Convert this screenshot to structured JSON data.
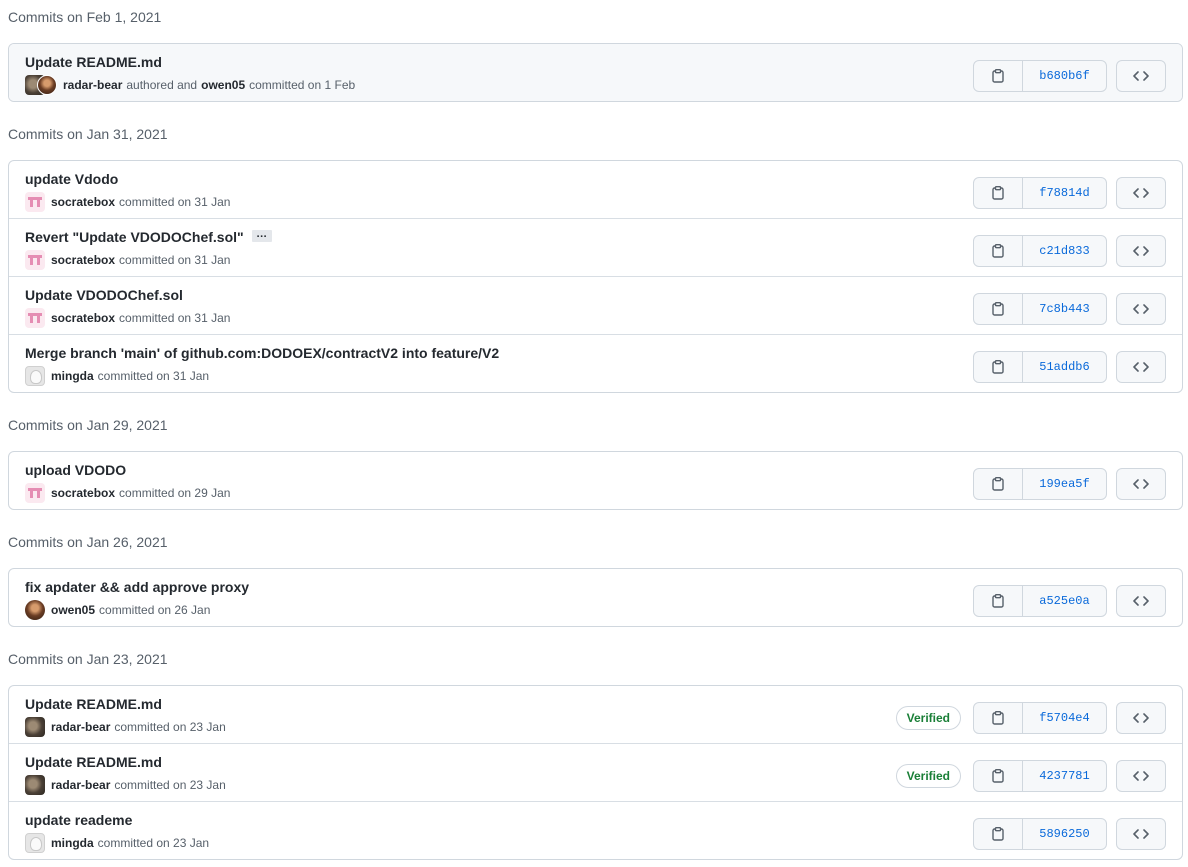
{
  "groups": [
    {
      "heading": "Commits on Feb 1, 2021",
      "commits": [
        {
          "title": "Update README.md",
          "authors": [
            "radar-bear",
            "owen05"
          ],
          "action": "authored and",
          "action2": "committed on 1 Feb",
          "sha": "b680b6f",
          "verified": false,
          "avatar": "pair"
        }
      ]
    },
    {
      "heading": "Commits on Jan 31, 2021",
      "commits": [
        {
          "title": "update Vdodo",
          "author": "socratebox",
          "action": "committed on 31 Jan",
          "sha": "f78814d",
          "verified": false,
          "avatar": "socrate"
        },
        {
          "title": "Revert \"Update VDODOChef.sol\"",
          "ellipsis": "…",
          "author": "socratebox",
          "action": "committed on 31 Jan",
          "sha": "c21d833",
          "verified": false,
          "avatar": "socrate"
        },
        {
          "title": "Update VDODOChef.sol",
          "author": "socratebox",
          "action": "committed on 31 Jan",
          "sha": "7c8b443",
          "verified": false,
          "avatar": "socrate"
        },
        {
          "title": "Merge branch 'main' of github.com:DODOEX/contractV2 into feature/V2",
          "author": "mingda",
          "action": "committed on 31 Jan",
          "sha": "51addb6",
          "verified": false,
          "avatar": "mingda"
        }
      ]
    },
    {
      "heading": "Commits on Jan 29, 2021",
      "commits": [
        {
          "title": "upload VDODO",
          "author": "socratebox",
          "action": "committed on 29 Jan",
          "sha": "199ea5f",
          "verified": false,
          "avatar": "socrate"
        }
      ]
    },
    {
      "heading": "Commits on Jan 26, 2021",
      "commits": [
        {
          "title": "fix apdater && add approve proxy",
          "author": "owen05",
          "action": "committed on 26 Jan",
          "sha": "a525e0a",
          "verified": false,
          "avatar": "owen"
        }
      ]
    },
    {
      "heading": "Commits on Jan 23, 2021",
      "commits": [
        {
          "title": "Update README.md",
          "author": "radar-bear",
          "action": "committed on 23 Jan",
          "sha": "f5704e4",
          "verified": true,
          "verified_label": "Verified",
          "avatar": "radar"
        },
        {
          "title": "Update README.md",
          "author": "radar-bear",
          "action": "committed on 23 Jan",
          "sha": "4237781",
          "verified": true,
          "verified_label": "Verified",
          "avatar": "radar"
        },
        {
          "title": "update reademe",
          "author": "mingda",
          "action": "committed on 23 Jan",
          "sha": "5896250",
          "verified": false,
          "avatar": "mingda"
        }
      ]
    }
  ],
  "icons": {
    "copy": "clipboard-icon",
    "browse": "code-icon"
  },
  "colors": {
    "sha_link": "#0969da",
    "verified": "#1a7f37",
    "border": "#d0d7de"
  }
}
